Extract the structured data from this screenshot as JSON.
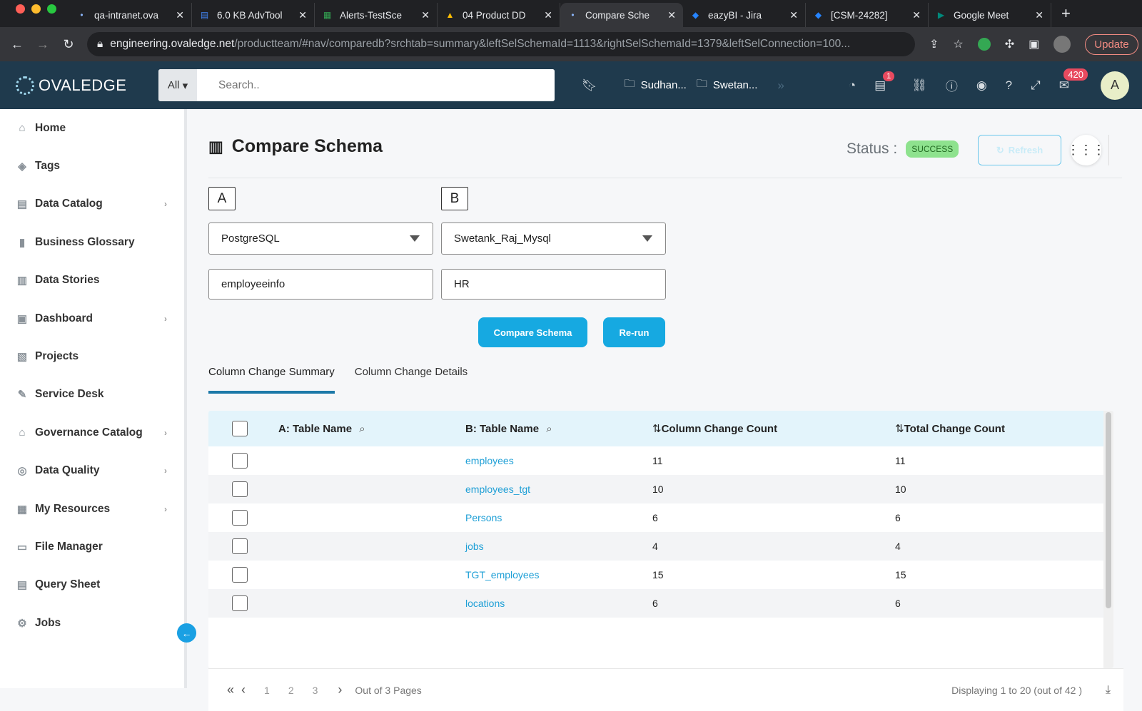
{
  "browser": {
    "tabs": [
      {
        "title": "qa-intranet.ova",
        "icon": "ovaledge-favicon",
        "active": false
      },
      {
        "title": "6.0 KB AdvTool",
        "icon": "google-docs-icon",
        "active": false
      },
      {
        "title": "Alerts-TestSce",
        "icon": "google-sheets-icon",
        "active": false
      },
      {
        "title": "04 Product DD",
        "icon": "google-drive-icon",
        "active": false
      },
      {
        "title": "Compare Sche",
        "icon": "ovaledge-favicon",
        "active": true
      },
      {
        "title": "eazyBI - Jira",
        "icon": "jira-icon",
        "active": false
      },
      {
        "title": "[CSM-24282]",
        "icon": "jira-icon",
        "active": false
      },
      {
        "title": "Google Meet",
        "icon": "google-meet-icon",
        "active": false
      }
    ],
    "url_host": "engineering.ovaledge.net",
    "url_path": "/productteam/#nav/comparedb?srchtab=summary&leftSelSchemaId=1113&rightSelSchemaId=1379&leftSelConnection=100...",
    "update_label": "Update"
  },
  "header": {
    "logo_text": "OVALEDGE",
    "search_scope": "All",
    "search_placeholder": "Search..",
    "folders": [
      "Sudhan...",
      "Swetan..."
    ],
    "notification_badge": "1",
    "mail_badge": "420",
    "avatar_letter": "A"
  },
  "sidebar": {
    "items": [
      {
        "label": "Home",
        "icon": "home-icon",
        "chevron": false
      },
      {
        "label": "Tags",
        "icon": "tag-icon",
        "chevron": false
      },
      {
        "label": "Data Catalog",
        "icon": "catalog-icon",
        "chevron": true
      },
      {
        "label": "Business Glossary",
        "icon": "book-icon",
        "chevron": false
      },
      {
        "label": "Data Stories",
        "icon": "stories-icon",
        "chevron": false
      },
      {
        "label": "Dashboard",
        "icon": "dashboard-icon",
        "chevron": true
      },
      {
        "label": "Projects",
        "icon": "projects-icon",
        "chevron": false
      },
      {
        "label": "Service Desk",
        "icon": "service-desk-icon",
        "chevron": false
      },
      {
        "label": "Governance Catalog",
        "icon": "governance-icon",
        "chevron": true
      },
      {
        "label": "Data Quality",
        "icon": "data-quality-icon",
        "chevron": true
      },
      {
        "label": "My Resources",
        "icon": "resources-icon",
        "chevron": true
      },
      {
        "label": "File Manager",
        "icon": "file-icon",
        "chevron": false
      },
      {
        "label": "Query Sheet",
        "icon": "query-icon",
        "chevron": false
      },
      {
        "label": "Jobs",
        "icon": "jobs-icon",
        "chevron": false
      }
    ]
  },
  "page": {
    "title": "Compare Schema",
    "status_label": "Status :",
    "status_value": "SUCCESS",
    "refresh_label": "Refresh",
    "side_a": {
      "label": "A",
      "connection": "PostgreSQL",
      "schema": "employeeinfo"
    },
    "side_b": {
      "label": "B",
      "connection": "Swetank_Raj_Mysql",
      "schema": "HR"
    },
    "compare_button": "Compare Schema",
    "rerun_button": "Re-run",
    "tabs": [
      "Column Change Summary",
      "Column Change Details"
    ],
    "table": {
      "headers": [
        "A: Table Name",
        "B: Table Name",
        "Column Change Count",
        "Total Change Count"
      ],
      "rows": [
        {
          "a": "",
          "b": "employees",
          "col": "11",
          "total": "11"
        },
        {
          "a": "",
          "b": "employees_tgt",
          "col": "10",
          "total": "10"
        },
        {
          "a": "",
          "b": "Persons",
          "col": "6",
          "total": "6"
        },
        {
          "a": "",
          "b": "jobs",
          "col": "4",
          "total": "4"
        },
        {
          "a": "",
          "b": "TGT_employees",
          "col": "15",
          "total": "15"
        },
        {
          "a": "",
          "b": "locations",
          "col": "6",
          "total": "6"
        }
      ]
    },
    "pager": {
      "pages": [
        "1",
        "2",
        "3"
      ],
      "out_of": "Out of 3 Pages",
      "displaying": "Displaying 1 to 20 (out of  42 )"
    }
  }
}
